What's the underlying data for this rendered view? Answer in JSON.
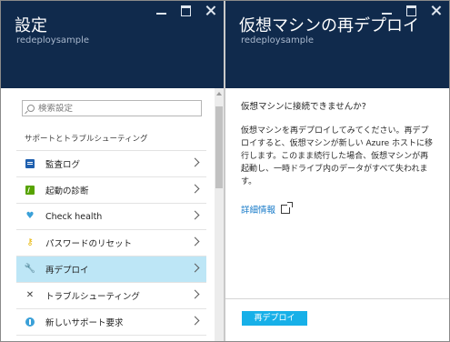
{
  "left_blade": {
    "title": "設定",
    "subtitle": "redeploysample",
    "search": {
      "placeholder": "検索設定",
      "value": ""
    },
    "section_label": "サポートとトラブルシューティング",
    "items": [
      {
        "label": "監査ログ",
        "icon": "audit-log-icon",
        "selected": false
      },
      {
        "label": "起動の診断",
        "icon": "boot-diagnostics-icon",
        "selected": false
      },
      {
        "label": "Check health",
        "icon": "heart-icon",
        "selected": false
      },
      {
        "label": "パスワードのリセット",
        "icon": "key-icon",
        "selected": false
      },
      {
        "label": "再デプロイ",
        "icon": "wrench-icon",
        "selected": true
      },
      {
        "label": "トラブルシューティング",
        "icon": "tools-icon",
        "selected": false
      },
      {
        "label": "新しいサポート要求",
        "icon": "support-icon",
        "selected": false
      }
    ]
  },
  "right_blade": {
    "title": "仮想マシンの再デプロイ",
    "subtitle": "redeploysample",
    "question": "仮想マシンに接続できませんか?",
    "description": "仮想マシンを再デプロイしてみてください。再デプロイすると、仮想マシンが新しい Azure ホストに移行します。このまま続行した場合、仮想マシンが再起動し、一時ドライブ内のデータがすべて失われます。",
    "more_link": "詳細情報",
    "button_label": "再デプロイ"
  },
  "colors": {
    "header_bg": "#102a4c",
    "selected_bg": "#bde6f6",
    "accent": "#17b0e8",
    "link": "#1579c8"
  }
}
